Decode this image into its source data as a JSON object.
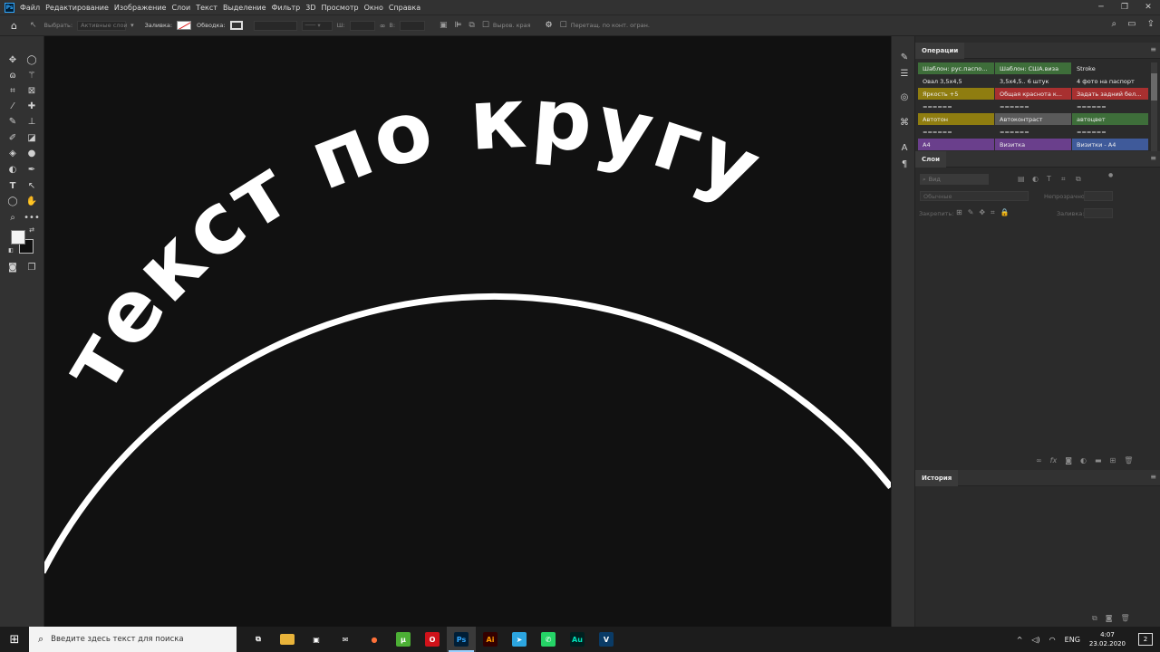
{
  "app": {
    "logo": "Ps"
  },
  "menu": [
    "Файл",
    "Редактирование",
    "Изображение",
    "Слои",
    "Текст",
    "Выделение",
    "Фильтр",
    "3D",
    "Просмотр",
    "Окно",
    "Справка"
  ],
  "options": {
    "select_label": "Выбрать:",
    "select_value": "Активные слои",
    "fill_label": "Заливка:",
    "stroke_label": "Обводка:",
    "w_label": "Ш:",
    "h_label": "В:",
    "align_edges": "Выров. края",
    "path_ops": "Перетащ. по конт. огран."
  },
  "canvas": {
    "text": "текст по кругу",
    "bg_color": "#111111",
    "fg_color": "#ffffff"
  },
  "actions_panel": {
    "title": "Операции",
    "cells": [
      {
        "label": "Шаблон: рус.паспо...",
        "color": "#3e6e3a"
      },
      {
        "label": "Шаблон: США.виза",
        "color": "#3e6e3a"
      },
      {
        "label": "Stroke",
        "color": "#2b2b2b"
      },
      {
        "label": "Овал 3,5х4,5",
        "color": "#2b2b2b"
      },
      {
        "label": "3,5х4,5.. 6 штук",
        "color": "#2b2b2b"
      },
      {
        "label": "4 фото на паспорт",
        "color": "#2b2b2b"
      },
      {
        "label": "Яркость +5",
        "color": "#8f7d10"
      },
      {
        "label": "Общая краснота к...",
        "color": "#a83030"
      },
      {
        "label": "Задать задний бел...",
        "color": "#a83030"
      },
      {
        "label": "======",
        "color": "#2b2b2b"
      },
      {
        "label": "======",
        "color": "#2b2b2b"
      },
      {
        "label": "======",
        "color": "#2b2b2b"
      },
      {
        "label": "Автотон",
        "color": "#8f7d10"
      },
      {
        "label": "Автоконтраст",
        "color": "#5a5a5a"
      },
      {
        "label": "автоцвет",
        "color": "#3e6e3a"
      },
      {
        "label": "======",
        "color": "#2b2b2b"
      },
      {
        "label": "======",
        "color": "#2b2b2b"
      },
      {
        "label": "======",
        "color": "#2b2b2b"
      },
      {
        "label": "А4",
        "color": "#6a3f8c"
      },
      {
        "label": "Визитка",
        "color": "#6a3f8c"
      },
      {
        "label": "Визитки - А4",
        "color": "#3f5a9a"
      }
    ]
  },
  "layers_panel": {
    "title": "Слои",
    "search_placeholder": "Вид",
    "blend_mode": "Обычные",
    "opacity_label": "Непрозрачность:",
    "lock_label": "Закрепить:",
    "fill_label": "Заливка:"
  },
  "history_panel": {
    "title": "История"
  },
  "taskbar": {
    "search_placeholder": "Введите здесь текст для поиска",
    "apps": [
      {
        "name": "task-view",
        "glyph": "⧉",
        "bg": "transparent",
        "fg": "#ffffff"
      },
      {
        "name": "explorer",
        "glyph": "▬",
        "bg": "#e8b33a",
        "fg": "#e8b33a"
      },
      {
        "name": "store",
        "glyph": "▣",
        "bg": "transparent",
        "fg": "#ffffff"
      },
      {
        "name": "mail",
        "glyph": "✉",
        "bg": "transparent",
        "fg": "#ffffff"
      },
      {
        "name": "firefox",
        "glyph": "●",
        "bg": "transparent",
        "fg": "#ff7139"
      },
      {
        "name": "utorrent",
        "glyph": "μ",
        "bg": "#4caf35",
        "fg": "#ffffff"
      },
      {
        "name": "opera",
        "glyph": "O",
        "bg": "#d0121a",
        "fg": "#ffffff"
      },
      {
        "name": "photoshop",
        "glyph": "Ps",
        "bg": "#001e36",
        "fg": "#31a8ff"
      },
      {
        "name": "illustrator",
        "glyph": "Ai",
        "bg": "#330000",
        "fg": "#ff9a00"
      },
      {
        "name": "telegram",
        "glyph": "➤",
        "bg": "#2ca5e0",
        "fg": "#ffffff"
      },
      {
        "name": "whatsapp",
        "glyph": "✆",
        "bg": "#25d366",
        "fg": "#ffffff"
      },
      {
        "name": "audition",
        "glyph": "Au",
        "bg": "#00201f",
        "fg": "#00e4bb"
      },
      {
        "name": "vegas",
        "glyph": "V",
        "bg": "#0a3b66",
        "fg": "#ffffff"
      }
    ],
    "lang": "ENG",
    "time": "4:07",
    "date": "23.02.2020",
    "notifications": "2"
  }
}
